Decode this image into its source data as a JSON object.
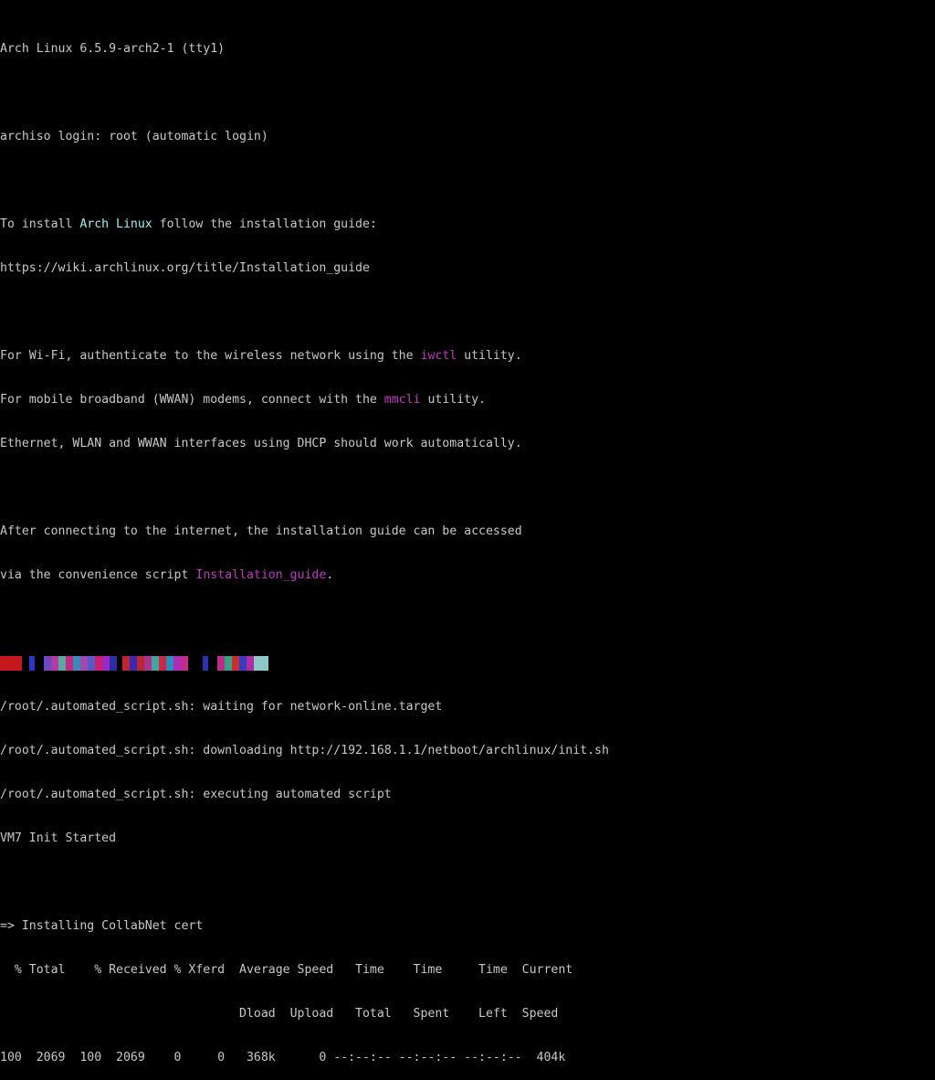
{
  "terminal": {
    "banner": "Arch Linux 6.5.9-arch2-1 (tty1)",
    "login_line": "archiso login: root (automatic login)",
    "install_prefix": "To install ",
    "install_highlight": "Arch Linux",
    "install_suffix": " follow the installation guide:",
    "guide_url": "https://wiki.archlinux.org/title/Installation_guide",
    "wifi_prefix": "For Wi-Fi, authenticate to the wireless network using the ",
    "wifi_tool": "iwctl",
    "wifi_suffix": " utility.",
    "mobile_prefix": "For mobile broadband (WWAN) modems, connect with the ",
    "mobile_tool": "mmcli",
    "mobile_suffix": " utility.",
    "ethernet_line": "Ethernet, WLAN and WWAN interfaces using DHCP should work automatically.",
    "after_line": "After connecting to the internet, the installation guide can be accessed",
    "via_prefix": "via the convenience script ",
    "via_script": "Installation_guide",
    "via_suffix": ".",
    "script_waiting": "/root/.automated_script.sh: waiting for network-online.target",
    "script_downloading": "/root/.automated_script.sh: downloading http://192.168.1.1/netboot/archlinux/init.sh",
    "script_executing": "/root/.automated_script.sh: executing automated script",
    "vm_init": "VM7 Init Started",
    "installing_cert": "=> Installing CollabNet cert",
    "curl_header_1": "  % Total    % Received % Xferd  Average Speed   Time    Time     Time  Current",
    "curl_header_2": "                                 Dload  Upload   Total   Spent    Left  Speed",
    "curl_progress": "100  2069  100  2069    0     0   368k      0 --:--:-- --:--:-- --:--:--  404k"
  },
  "colors": {
    "background": "#000000",
    "foreground": "#c8c8c8",
    "cyan_highlight": "#9ef0f0",
    "magenta_highlight": "#c238c2"
  }
}
